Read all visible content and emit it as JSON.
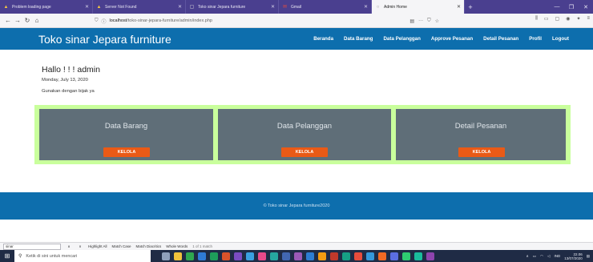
{
  "browser": {
    "tabs": [
      {
        "label": "Problem loading page",
        "icon": "warning-icon",
        "active": false
      },
      {
        "label": "Server Not Found",
        "icon": "warning-icon",
        "active": false
      },
      {
        "label": "Toko sinar Jepara furniture",
        "icon": "page-icon",
        "active": false
      },
      {
        "label": "Gmail",
        "icon": "gmail-icon",
        "active": false
      },
      {
        "label": "Admin Home",
        "icon": "page-icon",
        "active": true
      }
    ],
    "url_host": "localhost",
    "url_path": "/toko-sinar-jepara-furniture/admin/index.php"
  },
  "site": {
    "brand": "Toko sinar Jepara furniture",
    "menu": [
      "Beranda",
      "Data Barang",
      "Data Pelanggan",
      "Approve Pesanan",
      "Detail Pesanan",
      "Profil",
      "Logout"
    ],
    "colors": {
      "nav": "#0d6ead",
      "card": "#5f6e78",
      "card_border": "#c9ff9c",
      "button": "#ea5a16"
    }
  },
  "content": {
    "greeting": "Hallo ! ! ! admin",
    "date": "Monday, July 13, 2020",
    "note": "Gunakan dengan bijak ya",
    "cards": [
      {
        "title": "Data Barang",
        "button": "KELOLA"
      },
      {
        "title": "Data Pelanggan",
        "button": "KELOLA"
      },
      {
        "title": "Detail Pesanan",
        "button": "KELOLA"
      }
    ]
  },
  "footer": {
    "text": "© Toko sinar Jepara furniture2020"
  },
  "findbar": {
    "value": "sinar",
    "highlight_all": "Highlight All",
    "match_case": "Match Case",
    "match_diacritics": "Match Diacritics",
    "whole_words": "Whole Words",
    "count": "1 of 1 match"
  },
  "taskbar": {
    "search_placeholder": "Ketik di sini untuk mencari",
    "lang": "IND",
    "time": "22.06",
    "date": "13/07/2020"
  }
}
